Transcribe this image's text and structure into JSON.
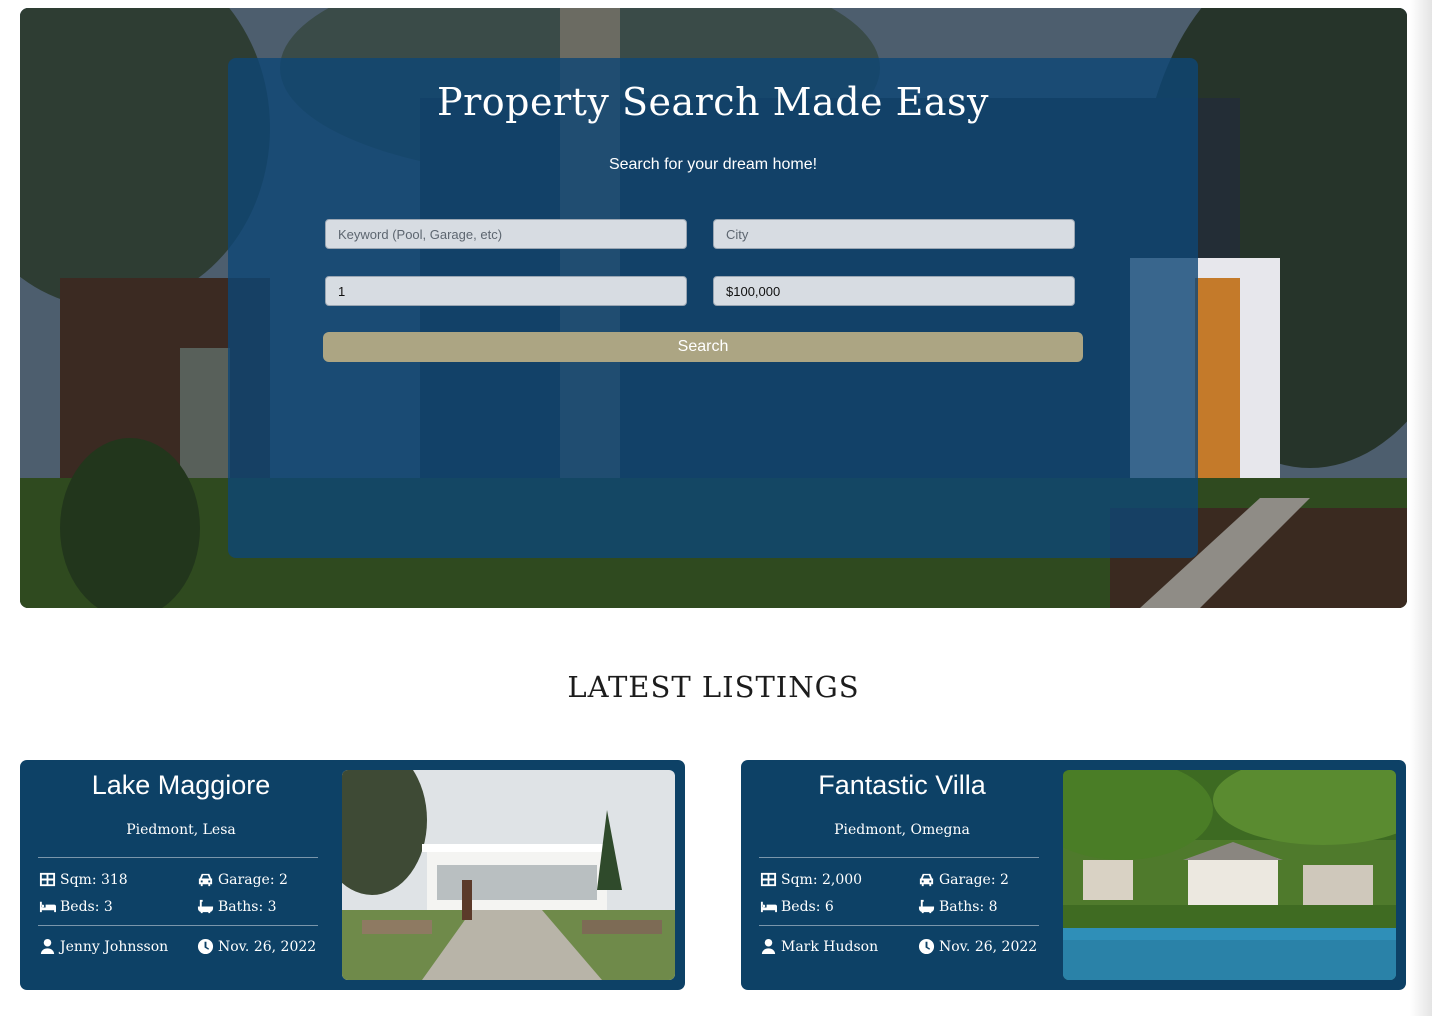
{
  "hero": {
    "title": "Property Search Made Easy",
    "subtitle": "Search for your dream home!",
    "keyword_placeholder": "Keyword (Pool, Garage, etc)",
    "city_placeholder": "City",
    "bedrooms_value": "1",
    "price_value": "$100,000",
    "search_label": "Search"
  },
  "colors": {
    "panel": "#0e4676",
    "search_button": "#aca583",
    "card": "#0d4166"
  },
  "listings_section": {
    "title": "LATEST LISTINGS"
  },
  "listings": [
    {
      "title": "Lake Maggiore",
      "location": "Piedmont, Lesa",
      "sqm": "Sqm: 318",
      "garage": "Garage: 2",
      "beds": "Beds: 3",
      "baths": "Baths: 3",
      "agent": "Jenny Johnsson",
      "date": "Nov. 26, 2022",
      "image": "modern white villa with garden steps"
    },
    {
      "title": "Fantastic Villa",
      "location": "Piedmont, Omegna",
      "sqm": "Sqm: 2,000",
      "garage": "Garage: 2",
      "beds": "Beds: 6",
      "baths": "Baths: 8",
      "agent": "Mark Hudson",
      "date": "Nov. 26, 2022",
      "image": "lakeside villa on green hillside"
    }
  ]
}
